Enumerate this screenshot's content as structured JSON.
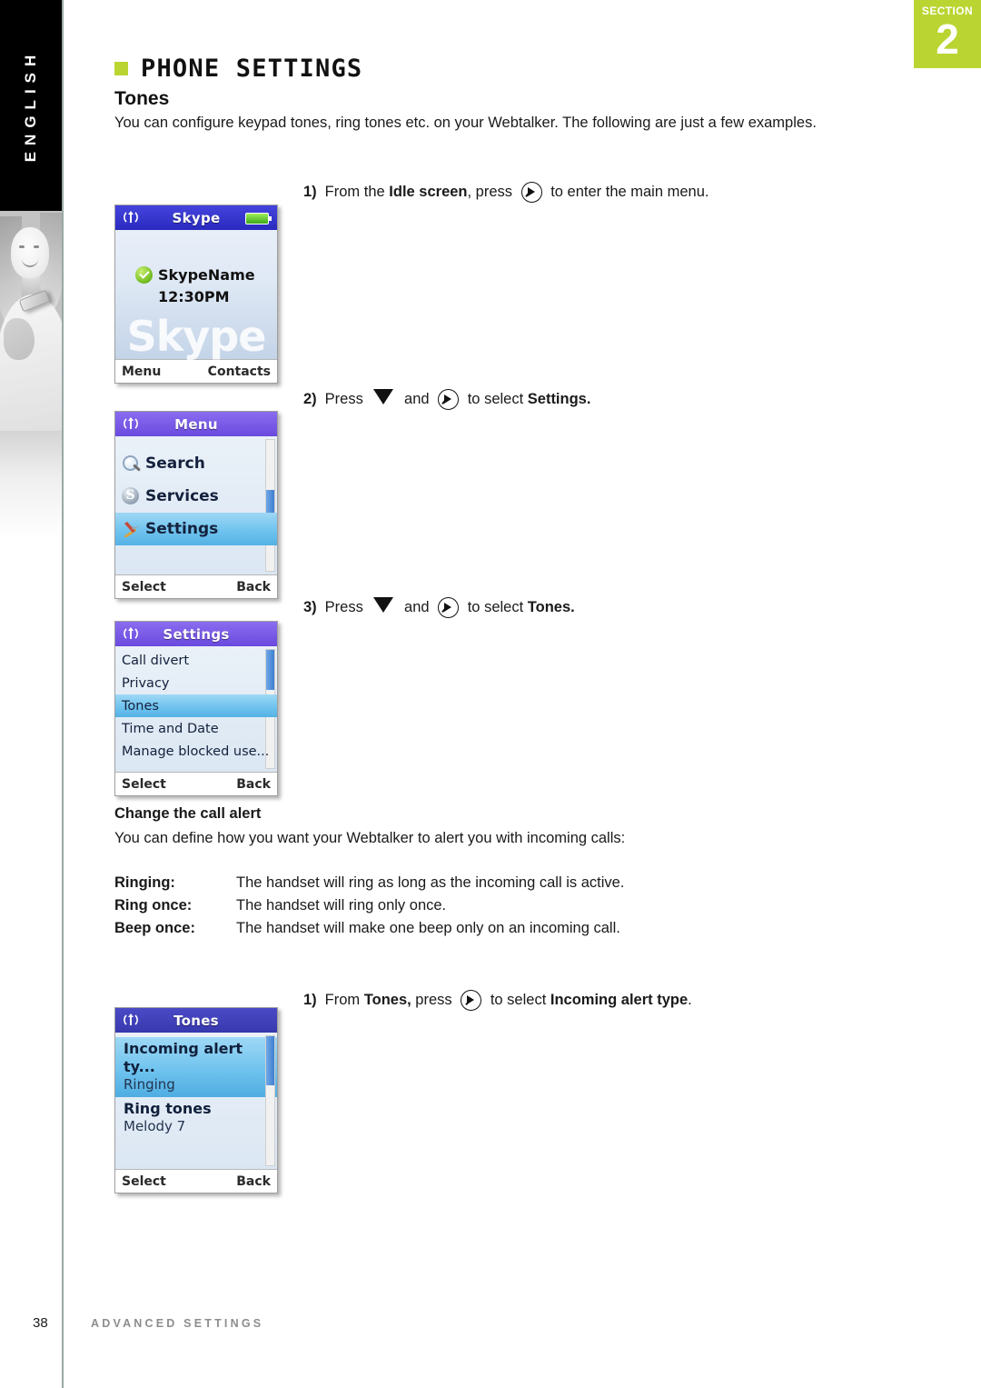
{
  "sidebar": {
    "language_label": "ENGLISH",
    "photo_alt": "woman-with-phone-photo"
  },
  "section_badge": {
    "word": "SECTION",
    "number": "2",
    "color": "#bad532"
  },
  "header": {
    "title": "PHONE SETTINGS",
    "bullet_color": "#bad532",
    "subtitle": "Tones",
    "intro": "You can configure keypad tones, ring tones etc. on your Webtalker. The following are just a few examples."
  },
  "steps": [
    {
      "num": "1)",
      "part1": "From the ",
      "bold1": "Idle screen",
      "part2": ", press ",
      "icon": "nav-right-icon",
      "part3": " to enter the main menu.",
      "bold2": "",
      "part4": ""
    },
    {
      "num": "2)",
      "part1": "Press ",
      "icon_down": "arrow-down-icon",
      "part2": " and ",
      "icon": "nav-right-icon",
      "part3": " to select ",
      "bold2": "Settings.",
      "part4": ""
    },
    {
      "num": "3)",
      "part1": "Press ",
      "icon_down": "arrow-down-icon",
      "part2": " and ",
      "icon": "nav-right-icon",
      "part3": " to select ",
      "bold2": "Tones.",
      "part4": ""
    },
    {
      "num": "1)",
      "part1": "From ",
      "bold1": "Tones,",
      "part2": " press ",
      "icon": "nav-right-icon",
      "part3": " to select ",
      "bold2": "Incoming alert type",
      "part4": "."
    }
  ],
  "call_alert": {
    "heading": "Change the call alert",
    "intro": "You can define how you want your Webtalker to alert you with incoming calls:",
    "rows": [
      {
        "term": "Ringing:",
        "desc": "The handset will ring as long as the incoming call is active."
      },
      {
        "term": "Ring once:",
        "desc": "The handset will ring only once."
      },
      {
        "term": "Beep once:",
        "desc": "The handset will make one beep only on an incoming call."
      }
    ]
  },
  "phone_screens": {
    "idle": {
      "header_title": "Skype",
      "header_color": "#3333cc",
      "signal_icon": "antenna-signal-icon",
      "battery_icon": "battery-full-icon",
      "status_icon": "online-check-icon",
      "username": "SkypeName",
      "time": "12:30PM",
      "watermark": "Skype",
      "softkey_left": "Menu",
      "softkey_right": "Contacts"
    },
    "menu": {
      "header_title": "Menu",
      "header_color": "#7a5ae8",
      "signal_icon": "antenna-signal-icon",
      "items": [
        {
          "label": "Search",
          "icon": "magnifier-icon",
          "selected": false
        },
        {
          "label": "Services",
          "icon": "skype-services-icon",
          "selected": false
        },
        {
          "label": "Settings",
          "icon": "tools-icon",
          "selected": true
        }
      ],
      "softkey_left": "Select",
      "softkey_right": "Back"
    },
    "settings": {
      "header_title": "Settings",
      "header_color": "#7a5ae8",
      "signal_icon": "antenna-signal-icon",
      "items": [
        {
          "label": "Call divert",
          "selected": false
        },
        {
          "label": "Privacy",
          "selected": false
        },
        {
          "label": "Tones",
          "selected": true
        },
        {
          "label": "Time and Date",
          "selected": false
        },
        {
          "label": "Manage blocked use...",
          "selected": false
        }
      ],
      "softkey_left": "Select",
      "softkey_right": "Back"
    },
    "tones": {
      "header_title": "Tones",
      "header_color": "#3c3cb4",
      "signal_icon": "antenna-signal-icon",
      "items": [
        {
          "label": "Incoming alert ty...",
          "value": "Ringing",
          "selected": true
        },
        {
          "label": "Ring tones",
          "value": "Melody 7",
          "selected": false
        }
      ],
      "softkey_left": "Select",
      "softkey_right": "Back"
    }
  },
  "footer": {
    "page_number": "38",
    "label": "ADVANCED SETTINGS"
  }
}
